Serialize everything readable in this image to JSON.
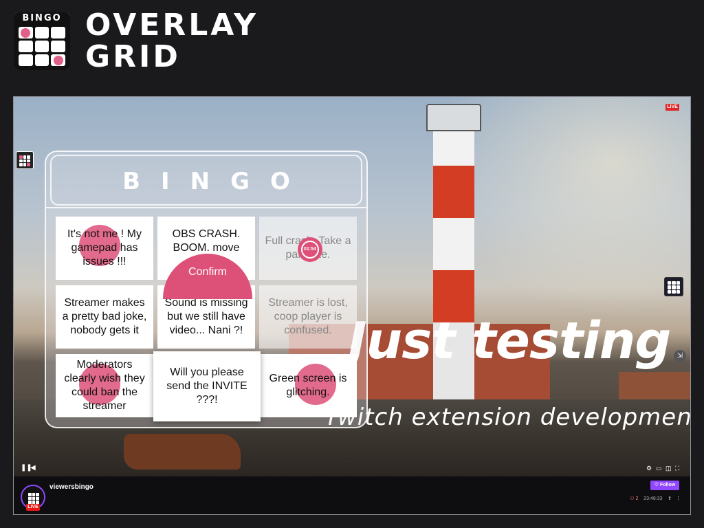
{
  "header": {
    "logo_text": "BINGO",
    "title_line1": "OVERLAY",
    "title_line2": "GRID"
  },
  "video": {
    "live_label": "LIVE",
    "overlay_title": "Just testing",
    "overlay_subtitle": "Twitch extension development"
  },
  "bingo": {
    "heading": "BINGO",
    "confirm_label": "Confirm",
    "timer": "01:54",
    "cells": [
      {
        "text": "It's not me ! My gamepad has issues !!!",
        "marked": true
      },
      {
        "text": "OBS CRASH. BOOM. move along.",
        "marked": false
      },
      {
        "text": "Full crash. Take a pancake.",
        "marked": false
      },
      {
        "text": "Streamer makes a pretty bad joke, nobody gets it",
        "marked": false
      },
      {
        "text": "Sound is missing but we still have video... Nani ?!",
        "marked": false
      },
      {
        "text": "Streamer is lost, coop player is confused.",
        "marked": false
      },
      {
        "text": "Moderators clearly wish they could ban the streamer",
        "marked": true
      },
      {
        "text": "Will you please send the INVITE ???!",
        "marked": false
      },
      {
        "text": "Green screen is glitching.",
        "marked": true
      }
    ]
  },
  "player": {
    "channel_name": "viewersbingo",
    "live_badge": "LIVE",
    "follow_label": "Follow",
    "follow_icon": "heart-icon",
    "viewers": "2",
    "uptime": "23:48:33",
    "controls_left": [
      "pause-icon",
      "volume-icon"
    ],
    "controls_right": [
      "gear-icon",
      "clip-icon",
      "theatre-icon",
      "fullscreen-icon"
    ]
  },
  "colors": {
    "mark": "#dd5078",
    "twitch_purple": "#9147ff",
    "live_red": "#e91916"
  }
}
